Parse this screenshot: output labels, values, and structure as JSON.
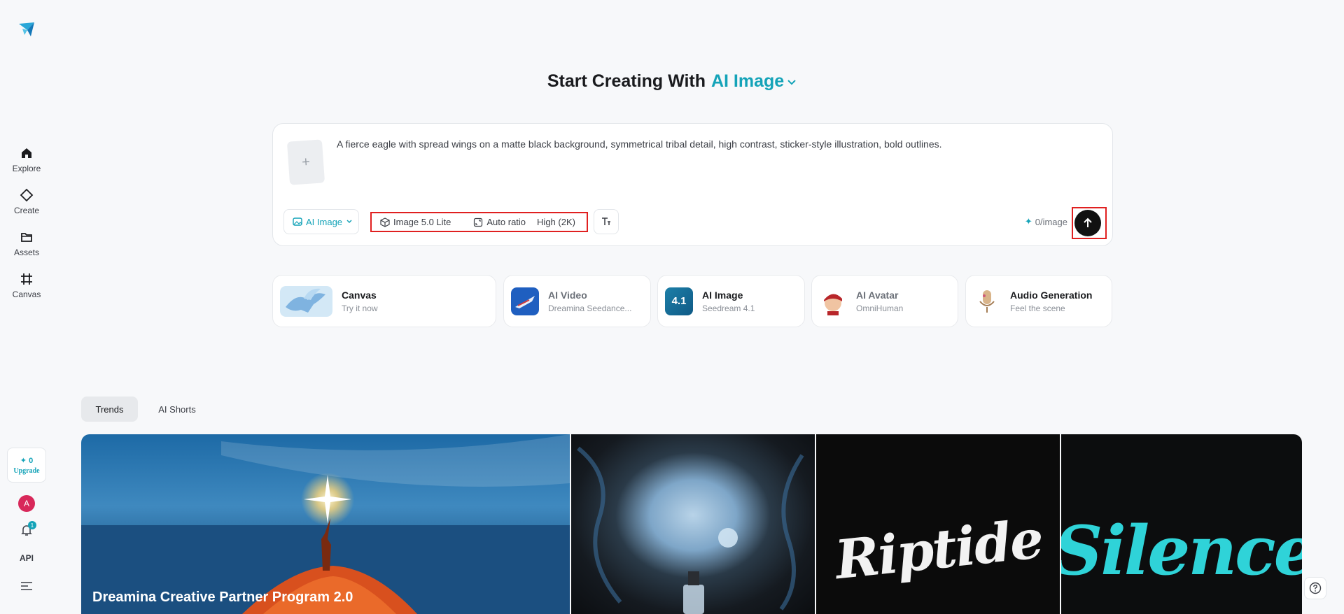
{
  "sidebar": {
    "items": [
      {
        "label": "Explore",
        "icon": "home-icon"
      },
      {
        "label": "Create",
        "icon": "diamond-icon"
      },
      {
        "label": "Assets",
        "icon": "folder-icon"
      },
      {
        "label": "Canvas",
        "icon": "crop-frame-icon"
      }
    ],
    "credits": "0",
    "upgrade_label": "Upgrade",
    "avatar_initial": "A",
    "notification_count": "1",
    "api_label": "API"
  },
  "hero": {
    "title_prefix": "Start Creating With",
    "title_accent": "AI Image"
  },
  "prompt": {
    "text": "A fierce eagle with spread wings on a matte black background, symmetrical tribal detail, high contrast, sticker-style illustration, bold outlines.",
    "add_reference": "+",
    "type_selector": "AI Image",
    "model": "Image 5.0 Lite",
    "ratio": "Auto ratio",
    "quality": "High (2K)",
    "cost": "0/image"
  },
  "tools": [
    {
      "name": "Canvas",
      "sub": "Try it now"
    },
    {
      "name": "AI Video",
      "sub": "Dreamina Seedance..."
    },
    {
      "name": "AI Image",
      "sub": "Seedream 4.1",
      "badge": "4.1"
    },
    {
      "name": "AI Avatar",
      "sub": "OmniHuman"
    },
    {
      "name": "Audio Generation",
      "sub": "Feel the scene"
    }
  ],
  "tabs": [
    {
      "label": "Trends",
      "active": true
    },
    {
      "label": "AI Shorts",
      "active": false
    }
  ],
  "gallery": {
    "featured_title": "Dreamina Creative Partner Program 2.0",
    "tile3_word": "Riptide",
    "tile4_word": "Silence"
  },
  "colors": {
    "accent": "#14a3b8",
    "highlight_frame": "#e02020",
    "send_button": "#111111"
  }
}
